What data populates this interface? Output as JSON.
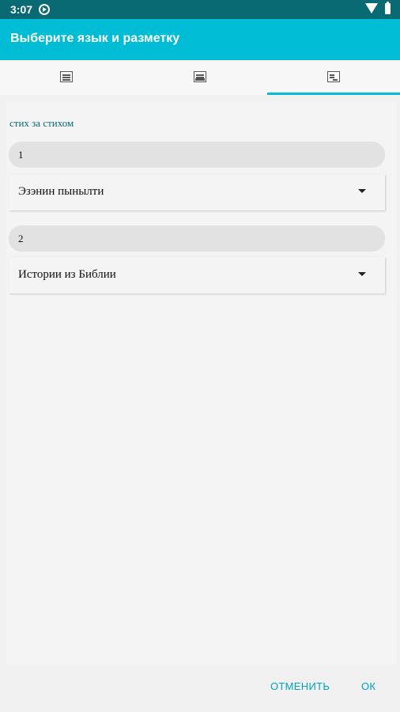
{
  "status_bar": {
    "time": "3:07"
  },
  "app_bar": {
    "title": "Выберите язык и разметку"
  },
  "tabs": [
    {
      "icon": "document-icon"
    },
    {
      "icon": "book-icon"
    },
    {
      "icon": "layout-icon"
    }
  ],
  "section": {
    "label": "стих за стихом",
    "rows": [
      {
        "number": "1",
        "selection": "Эзэнин пынылти"
      },
      {
        "number": "2",
        "selection": "Истории из Библии"
      }
    ]
  },
  "dialog": {
    "cancel_label": "ОТМЕНИТЬ",
    "ok_label": "ОК"
  },
  "colors": {
    "accent": "#00bcd4",
    "status_bar": "#0a6a74"
  }
}
